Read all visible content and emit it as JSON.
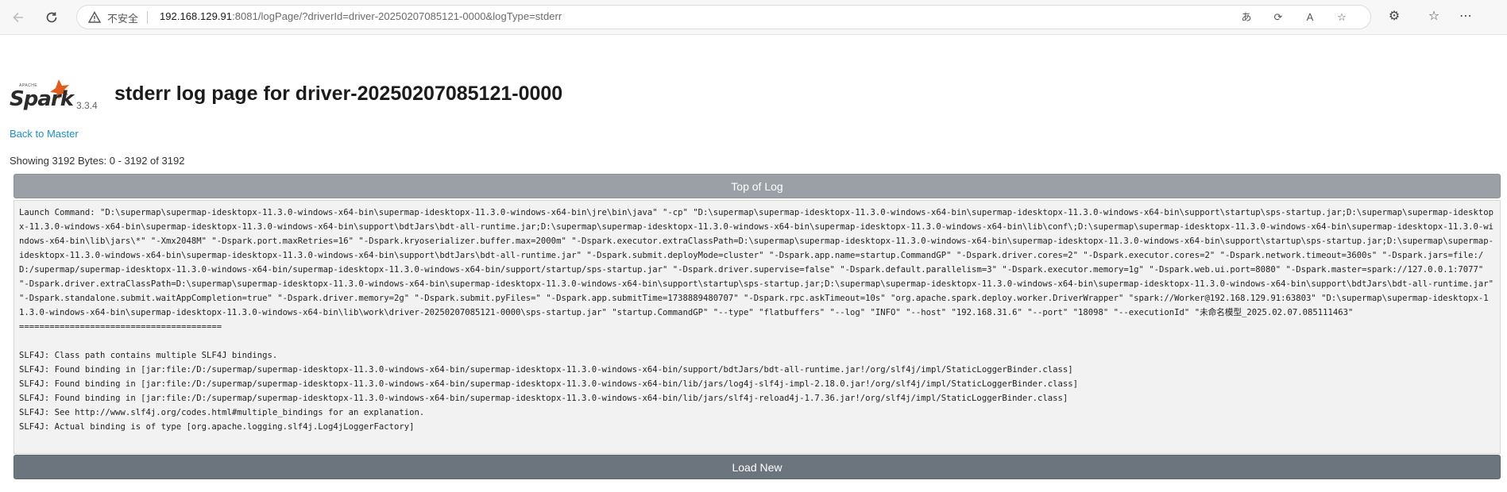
{
  "browser": {
    "security_label": "不安全",
    "url_host": "192.168.129.91",
    "url_rest": ":8081/logPage/?driverId=driver-20250207085121-0000&logType=stderr"
  },
  "header": {
    "logo_text": "Spark",
    "logo_apache": "APACHE",
    "version": "3.3.4",
    "title": "stderr log page for driver-20250207085121-0000"
  },
  "nav": {
    "back_link": "Back to Master"
  },
  "log": {
    "showing": "Showing 3192 Bytes: 0 - 3192 of 3192",
    "top_button": "Top of Log",
    "load_button": "Load New",
    "content": "Launch Command: \"D:\\supermap\\supermap-idesktopx-11.3.0-windows-x64-bin\\supermap-idesktopx-11.3.0-windows-x64-bin\\jre\\bin\\java\" \"-cp\" \"D:\\supermap\\supermap-idesktopx-11.3.0-windows-x64-bin\\supermap-idesktopx-11.3.0-windows-x64-bin\\support\\startup\\sps-startup.jar;D:\\supermap\\supermap-idesktopx-11.3.0-windows-x64-bin\\supermap-idesktopx-11.3.0-windows-x64-bin\\support\\bdtJars\\bdt-all-runtime.jar;D:\\supermap\\supermap-idesktopx-11.3.0-windows-x64-bin\\supermap-idesktopx-11.3.0-windows-x64-bin\\lib\\conf\\;D:\\supermap\\supermap-idesktopx-11.3.0-windows-x64-bin\\supermap-idesktopx-11.3.0-windows-x64-bin\\lib\\jars\\*\" \"-Xmx2048M\" \"-Dspark.port.maxRetries=16\" \"-Dspark.kryoserializer.buffer.max=2000m\" \"-Dspark.executor.extraClassPath=D:\\supermap\\supermap-idesktopx-11.3.0-windows-x64-bin\\supermap-idesktopx-11.3.0-windows-x64-bin\\support\\startup\\sps-startup.jar;D:\\supermap\\supermap-idesktopx-11.3.0-windows-x64-bin\\supermap-idesktopx-11.3.0-windows-x64-bin\\support\\bdtJars\\bdt-all-runtime.jar\" \"-Dspark.submit.deployMode=cluster\" \"-Dspark.app.name=startup.CommandGP\" \"-Dspark.driver.cores=2\" \"-Dspark.executor.cores=2\" \"-Dspark.network.timeout=3600s\" \"-Dspark.jars=file:/D:/supermap/supermap-idesktopx-11.3.0-windows-x64-bin/supermap-idesktopx-11.3.0-windows-x64-bin/support/startup/sps-startup.jar\" \"-Dspark.driver.supervise=false\" \"-Dspark.default.parallelism=3\" \"-Dspark.executor.memory=1g\" \"-Dspark.web.ui.port=8080\" \"-Dspark.master=spark://127.0.0.1:7077\" \"-Dspark.driver.extraClassPath=D:\\supermap\\supermap-idesktopx-11.3.0-windows-x64-bin\\supermap-idesktopx-11.3.0-windows-x64-bin\\support\\startup\\sps-startup.jar;D:\\supermap\\supermap-idesktopx-11.3.0-windows-x64-bin\\supermap-idesktopx-11.3.0-windows-x64-bin\\support\\bdtJars\\bdt-all-runtime.jar\" \"-Dspark.standalone.submit.waitAppCompletion=true\" \"-Dspark.driver.memory=2g\" \"-Dspark.submit.pyFiles=\" \"-Dspark.app.submitTime=1738889480707\" \"-Dspark.rpc.askTimeout=10s\" \"org.apache.spark.deploy.worker.DriverWrapper\" \"spark://Worker@192.168.129.91:63803\" \"D:\\supermap\\supermap-idesktopx-11.3.0-windows-x64-bin\\supermap-idesktopx-11.3.0-windows-x64-bin\\lib\\work\\driver-20250207085121-0000\\sps-startup.jar\" \"startup.CommandGP\" \"--type\" \"flatbuffers\" \"--log\" \"INFO\" \"--host\" \"192.168.31.6\" \"--port\" \"18098\" \"--executionId\" \"未命名模型_2025.02.07.085111463\"\n========================================\n\nSLF4J: Class path contains multiple SLF4J bindings.\nSLF4J: Found binding in [jar:file:/D:/supermap/supermap-idesktopx-11.3.0-windows-x64-bin/supermap-idesktopx-11.3.0-windows-x64-bin/support/bdtJars/bdt-all-runtime.jar!/org/slf4j/impl/StaticLoggerBinder.class]\nSLF4J: Found binding in [jar:file:/D:/supermap/supermap-idesktopx-11.3.0-windows-x64-bin/supermap-idesktopx-11.3.0-windows-x64-bin/lib/jars/log4j-slf4j-impl-2.18.0.jar!/org/slf4j/impl/StaticLoggerBinder.class]\nSLF4J: Found binding in [jar:file:/D:/supermap/supermap-idesktopx-11.3.0-windows-x64-bin/supermap-idesktopx-11.3.0-windows-x64-bin/lib/jars/slf4j-reload4j-1.7.36.jar!/org/slf4j/impl/StaticLoggerBinder.class]\nSLF4J: See http://www.slf4j.org/codes.html#multiple_bindings for an explanation.\nSLF4J: Actual binding is of type [org.apache.logging.slf4j.Log4jLoggerFactory]"
  },
  "icons": {
    "back": "arrow-left-icon",
    "reload": "reload-icon",
    "warning": "warning-icon",
    "read_aloud": "read-aloud-icon",
    "favorites": "star-icon"
  }
}
